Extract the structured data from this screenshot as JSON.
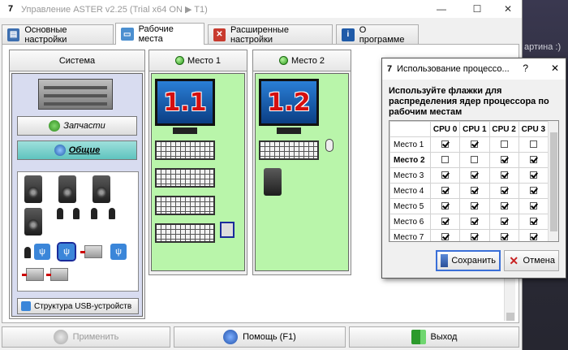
{
  "window": {
    "title": "Управление ASTER v2.25 (Trial x64 ON ▶ T1)",
    "minimize_glyph": "—",
    "maximize_glyph": "☐",
    "close_glyph": "✕",
    "app_icon": "7"
  },
  "background_text": "артина :)",
  "tabs": [
    {
      "label": "Основные настройки",
      "icon": "settings-icon"
    },
    {
      "label": "Рабочие места",
      "icon": "workplaces-icon"
    },
    {
      "label": "Расширенные настройки",
      "icon": "tools-icon"
    },
    {
      "label": "О программе",
      "icon": "info-icon"
    }
  ],
  "system": {
    "header": "Система",
    "parts_button": "Запчасти",
    "common_button": "Общие",
    "usb_structure_button": "Структура USB-устройств"
  },
  "places": [
    {
      "header": "Место 1",
      "monitor_label": "1.1"
    },
    {
      "header": "Место 2",
      "monitor_label": "1.2"
    }
  ],
  "footer": {
    "apply": "Применить",
    "help": "Помощь (F1)",
    "exit": "Выход"
  },
  "dialog": {
    "title": "Использование процессо...",
    "help_glyph": "?",
    "close_glyph": "✕",
    "description": "Используйте флажки для распределения ядер процессора по рабочим местам",
    "columns": [
      "",
      "CPU 0",
      "CPU 1",
      "CPU 2",
      "CPU 3"
    ],
    "rows": [
      {
        "name": "Место 1",
        "checks": [
          true,
          true,
          false,
          false
        ]
      },
      {
        "name": "Место 2",
        "checks": [
          false,
          false,
          true,
          true
        ]
      },
      {
        "name": "Место 3",
        "checks": [
          true,
          true,
          true,
          true
        ]
      },
      {
        "name": "Место 4",
        "checks": [
          true,
          true,
          true,
          true
        ]
      },
      {
        "name": "Место 5",
        "checks": [
          true,
          true,
          true,
          true
        ]
      },
      {
        "name": "Место 6",
        "checks": [
          true,
          true,
          true,
          true
        ]
      },
      {
        "name": "Место 7",
        "checks": [
          true,
          true,
          true,
          true
        ]
      }
    ],
    "save": "Сохранить",
    "cancel": "Отмена"
  },
  "colors": {
    "place_bg": "#b9f5aa",
    "system_bg": "#d8dcf0",
    "common_button": "#5fc3be",
    "monitor_label": "#d50f0f"
  }
}
